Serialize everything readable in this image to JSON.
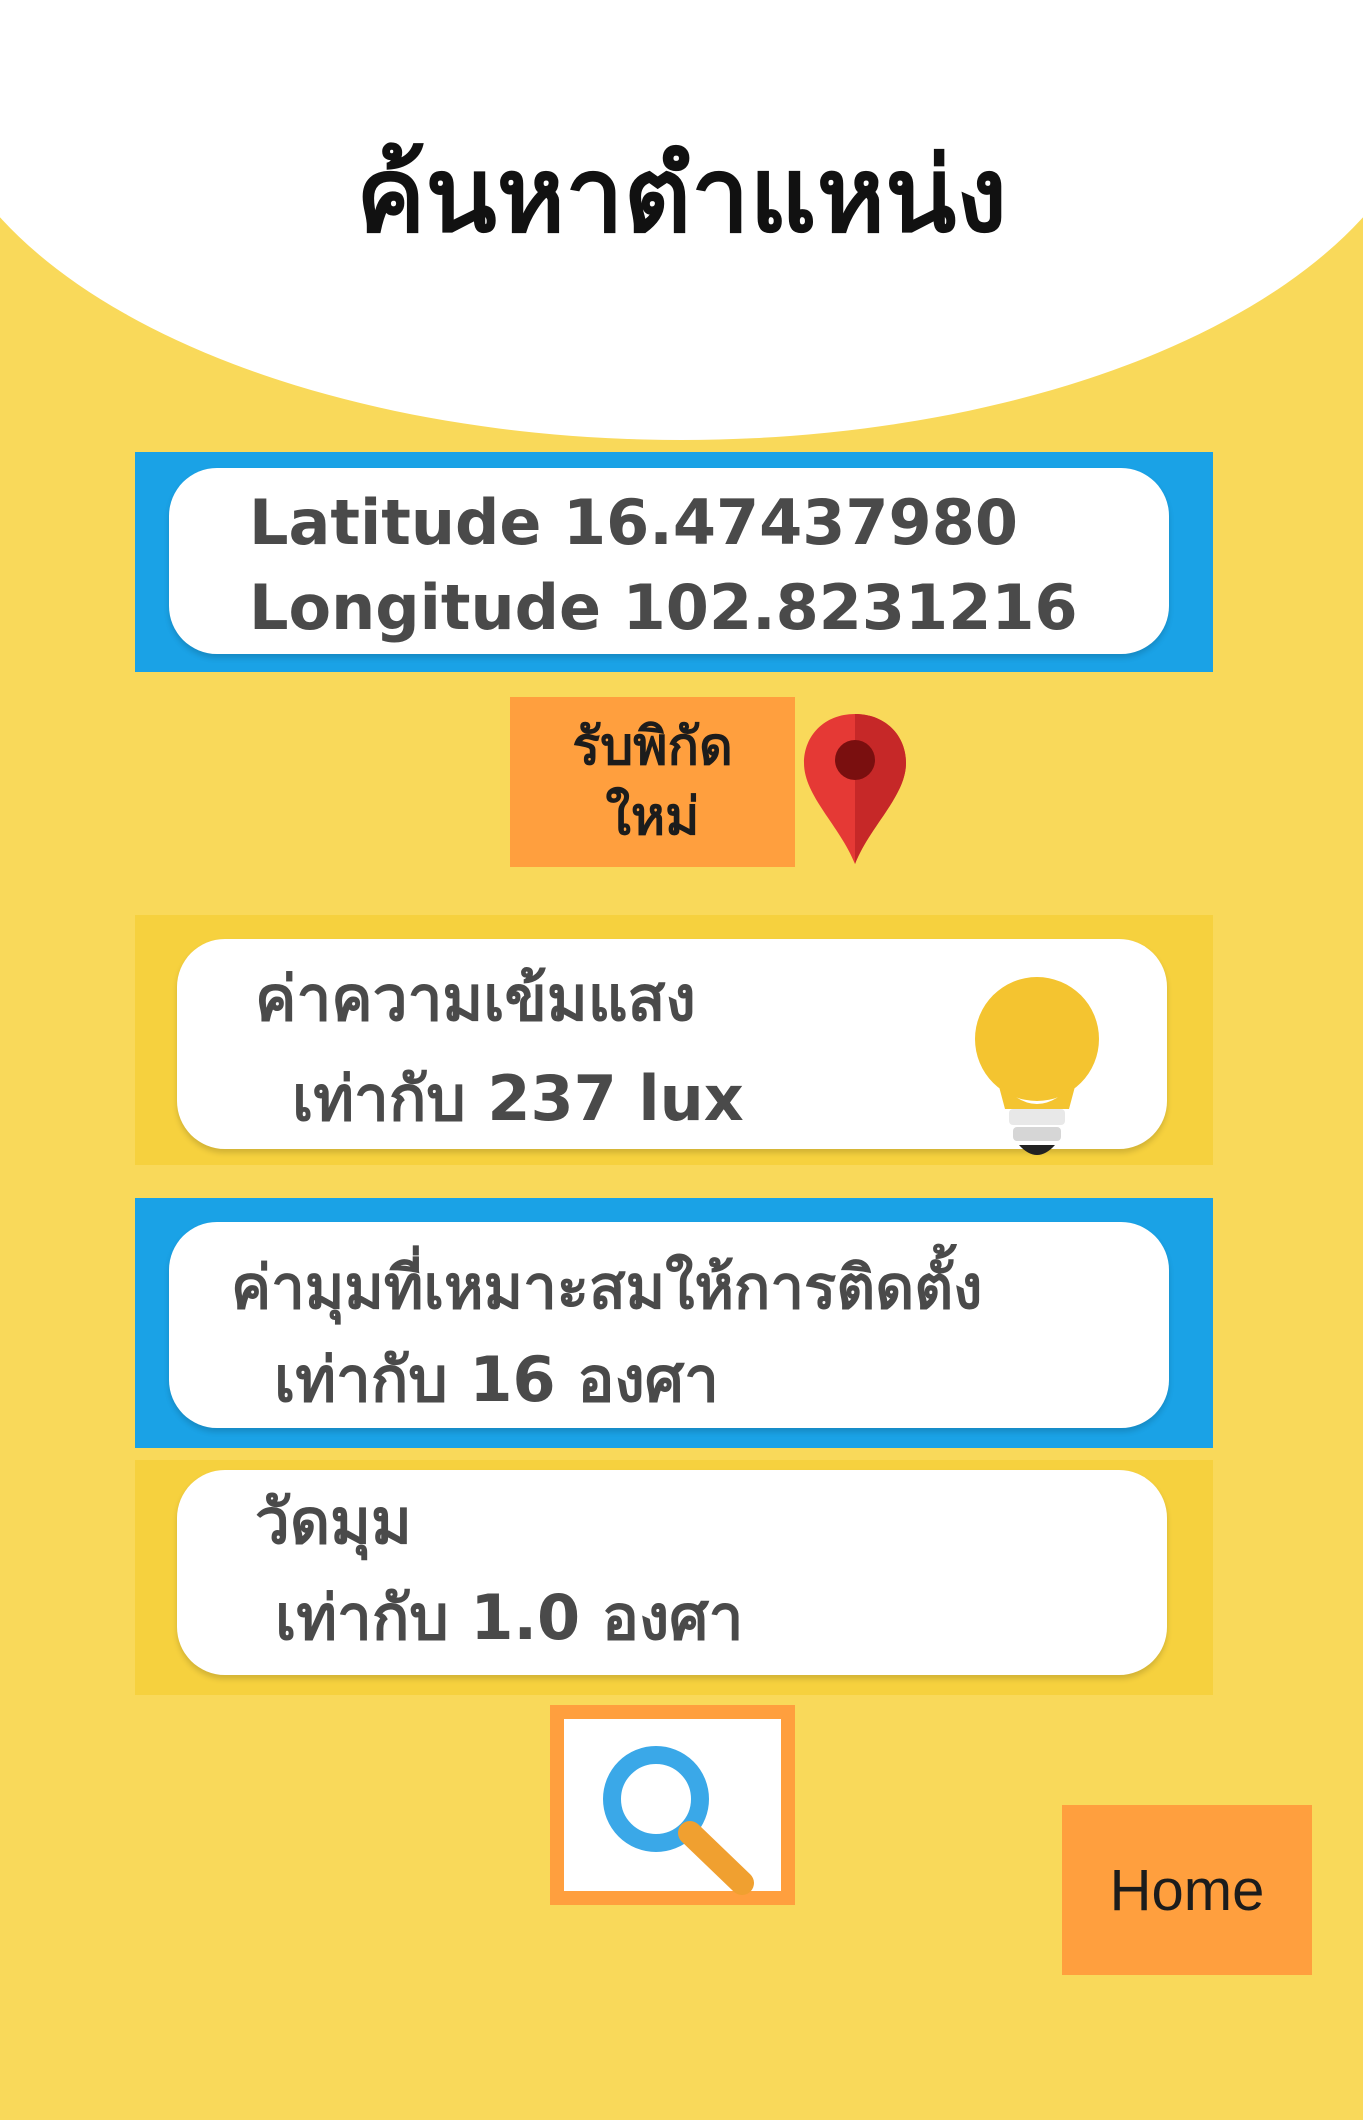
{
  "header": {
    "title": "ค้นหาตำแหน่ง"
  },
  "coordinates": {
    "latitude_text": "Latitude 16.47437980",
    "longitude_text": "Longitude 102.8231216"
  },
  "new_coordinates_button": {
    "line1": "รับพิกัด",
    "line2": "ใหม่"
  },
  "light_intensity": {
    "title": "ค่าความเข้มแสง",
    "value_text": "เท่ากับ 237 lux"
  },
  "optimal_angle": {
    "title": "ค่ามุมที่เหมาะสมให้การติดตั้ง",
    "value_text": "เท่ากับ 16 องศา"
  },
  "measure_angle": {
    "title": "วัดมุม",
    "value_text": "เท่ากับ 1.0 องศา"
  },
  "home_button": {
    "label": "Home"
  },
  "icons": {
    "pin": "map-pin-icon",
    "bulb": "light-bulb-icon",
    "search": "search-icon"
  },
  "colors": {
    "background": "#f9d95a",
    "blue_panel": "#1aa2e6",
    "yellow_panel": "#f6d13e",
    "button_orange": "#ff9f3e"
  }
}
